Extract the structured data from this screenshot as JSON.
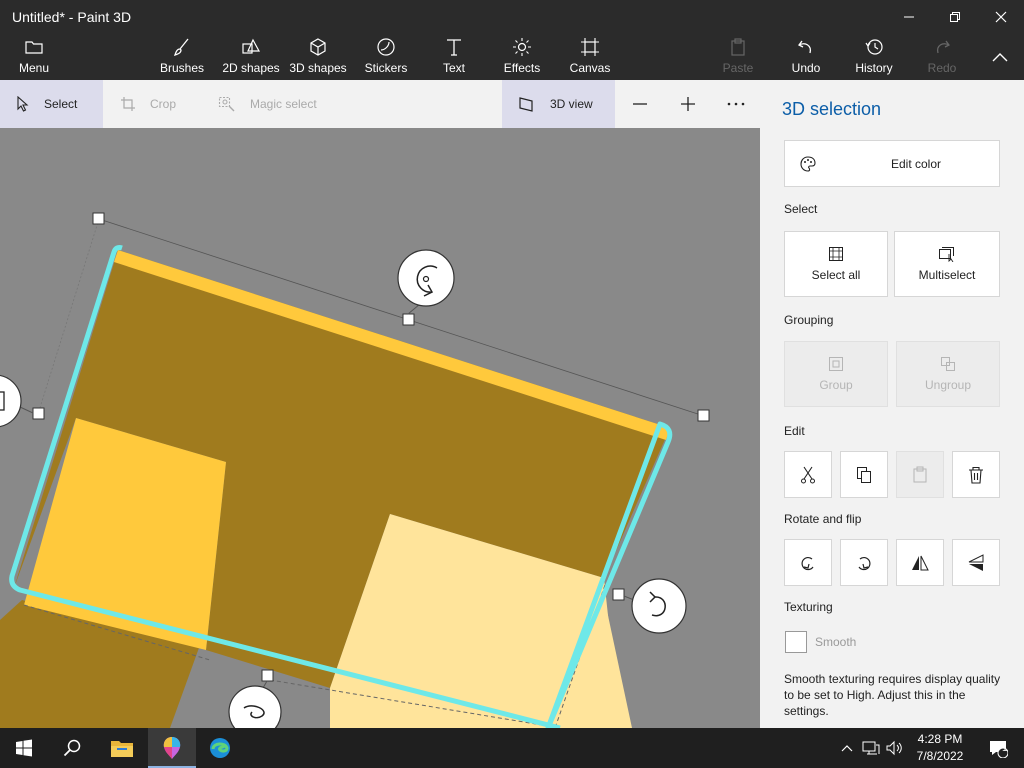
{
  "window": {
    "title": "Untitled* - Paint 3D"
  },
  "ribbon": {
    "menu": "Menu",
    "brushes": "Brushes",
    "shapes_2d": "2D shapes",
    "shapes_3d": "3D shapes",
    "stickers": "Stickers",
    "text": "Text",
    "effects": "Effects",
    "canvas": "Canvas",
    "paste": "Paste",
    "undo": "Undo",
    "history": "History",
    "redo": "Redo"
  },
  "toolbar": {
    "select": "Select",
    "crop": "Crop",
    "magic_select": "Magic select",
    "view_3d": "3D view"
  },
  "panel": {
    "title": "3D selection",
    "edit_color": "Edit color",
    "select_heading": "Select",
    "select_all": "Select all",
    "multiselect": "Multiselect",
    "grouping_heading": "Grouping",
    "group": "Group",
    "ungroup": "Ungroup",
    "edit_heading": "Edit",
    "rotate_heading": "Rotate and flip",
    "texturing_heading": "Texturing",
    "smooth": "Smooth",
    "smooth_checked": false,
    "note": "Smooth texturing requires display quality to be set to High. Adjust this in the settings."
  },
  "taskbar": {
    "time": "4:28 PM",
    "date": "7/8/2022",
    "notifications": "1"
  },
  "colors": {
    "chrome": "#2b2b2b",
    "accent": "#0c5ea8",
    "selection": "#6ee8e8",
    "shape_dark": "#a07b1e",
    "shape_light": "#ffc93c",
    "shape_pale": "#ffe49b"
  }
}
